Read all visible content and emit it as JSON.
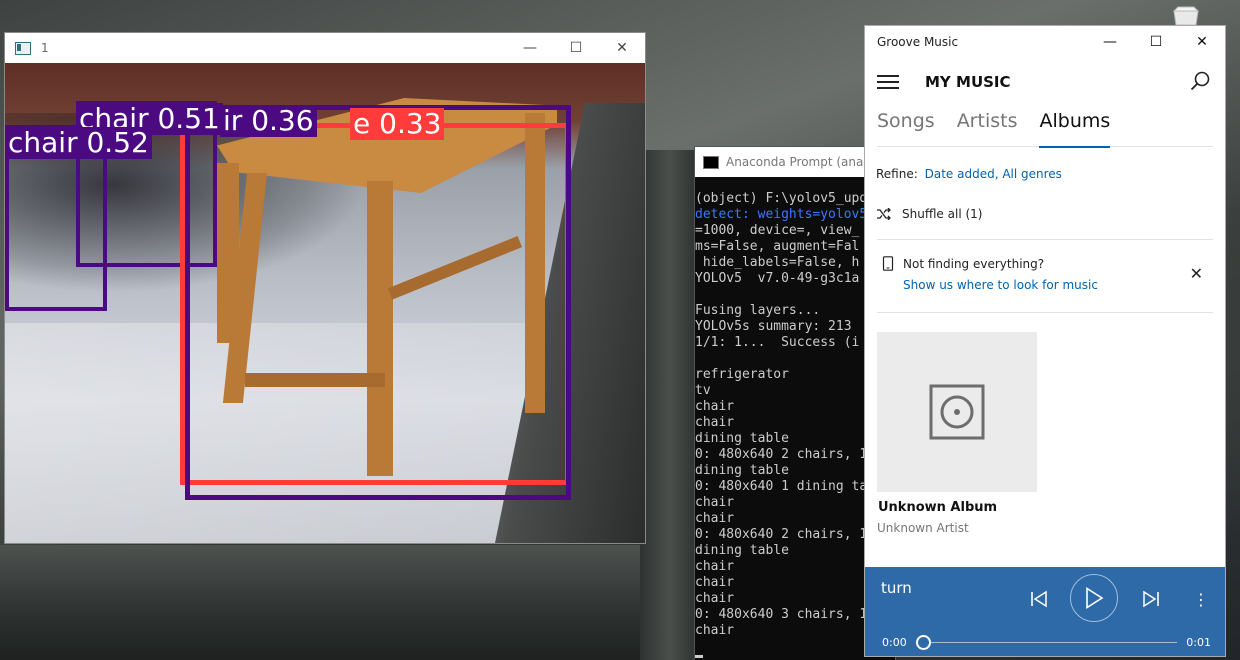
{
  "camera_window": {
    "title": "1",
    "controls": {
      "minimize": "—",
      "maximize": "☐",
      "close": "✕"
    },
    "detections": [
      {
        "label": "chair 0.52",
        "color": "#4b0a82"
      },
      {
        "label": "chair 0.51",
        "color": "#4b0a82"
      },
      {
        "label": "ir 0.36",
        "color": "#4b0a82"
      },
      {
        "label": "e 0.33",
        "color": "#ff3b3b"
      }
    ]
  },
  "prompt_window": {
    "title": "Anaconda Prompt (anacon",
    "lines": [
      {
        "text": "(object) F:\\yolov5_upd",
        "style": "normal"
      },
      {
        "text": "detect: weights=yolov5",
        "style": "blue"
      },
      {
        "text": "=1000, device=, view_",
        "style": "normal"
      },
      {
        "text": "ms=False, augment=Fal",
        "style": "normal"
      },
      {
        "text": " hide_labels=False, h",
        "style": "normal"
      },
      {
        "text": "YOLOv5  v7.0-49-g3c1a",
        "style": "normal"
      },
      {
        "text": "",
        "style": "normal"
      },
      {
        "text": "Fusing layers...",
        "style": "normal"
      },
      {
        "text": "YOLOv5s summary: 213",
        "style": "normal"
      },
      {
        "text": "1/1: 1...  Success (i",
        "style": "normal"
      },
      {
        "text": "",
        "style": "normal"
      },
      {
        "text": "refrigerator",
        "style": "normal"
      },
      {
        "text": "tv",
        "style": "normal"
      },
      {
        "text": "chair",
        "style": "normal"
      },
      {
        "text": "chair",
        "style": "normal"
      },
      {
        "text": "dining table",
        "style": "normal"
      },
      {
        "text": "0: 480x640 2 chairs, 1",
        "style": "normal"
      },
      {
        "text": "dining table",
        "style": "normal"
      },
      {
        "text": "0: 480x640 1 dining ta",
        "style": "normal"
      },
      {
        "text": "chair",
        "style": "normal"
      },
      {
        "text": "chair",
        "style": "normal"
      },
      {
        "text": "0: 480x640 2 chairs, 1",
        "style": "normal"
      },
      {
        "text": "dining table",
        "style": "normal"
      },
      {
        "text": "chair",
        "style": "normal"
      },
      {
        "text": "chair",
        "style": "normal"
      },
      {
        "text": "chair",
        "style": "normal"
      },
      {
        "text": "0: 480x640 3 chairs, 1",
        "style": "normal"
      },
      {
        "text": "chair",
        "style": "normal"
      }
    ]
  },
  "groove": {
    "app_title": "Groove Music",
    "controls": {
      "minimize": "—",
      "maximize": "☐",
      "close": "✕"
    },
    "heading": "MY MUSIC",
    "tabs": [
      "Songs",
      "Artists",
      "Albums"
    ],
    "active_tab": "Albums",
    "refine_label": "Refine:",
    "refine_value": "Date added, All genres",
    "shuffle_label": "Shuffle all (1)",
    "notice_text": "Not finding everything?",
    "notice_link": "Show us where to look for music",
    "album": {
      "title": "Unknown Album",
      "artist": "Unknown Artist"
    },
    "player": {
      "now_playing": "turn",
      "time_elapsed": "0:00",
      "time_total": "0:01",
      "progress": 0.0
    },
    "accent_color": "#0063b1",
    "player_color": "#2e6aa8"
  }
}
